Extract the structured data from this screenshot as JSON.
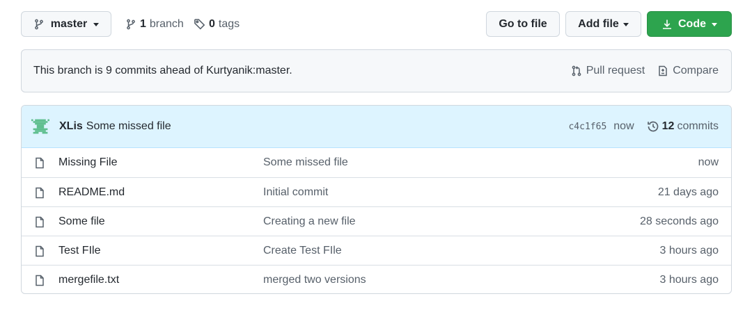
{
  "toolbar": {
    "branch_name": "master",
    "branches_count": "1",
    "branches_label": "branch",
    "tags_count": "0",
    "tags_label": "tags",
    "goto_file_label": "Go to file",
    "add_file_label": "Add file",
    "code_label": "Code"
  },
  "ahead_notice": {
    "text": "This branch is 9 commits ahead of Kurtyanik:master.",
    "pull_request_label": "Pull request",
    "compare_label": "Compare"
  },
  "latest_commit": {
    "author": "XLis",
    "message": "Some missed file",
    "sha": "c4c1f65",
    "time": "now",
    "commits_count": "12",
    "commits_label": "commits"
  },
  "files": [
    {
      "name": "Missing File",
      "commit": "Some missed file",
      "age": "now"
    },
    {
      "name": "README.md",
      "commit": "Initial commit",
      "age": "21 days ago"
    },
    {
      "name": "Some file",
      "commit": "Creating a new file",
      "age": "28 seconds ago"
    },
    {
      "name": "Test FIle",
      "commit": "Create Test FIle",
      "age": "3 hours ago"
    },
    {
      "name": "mergefile.txt",
      "commit": "merged two versions",
      "age": "3 hours ago"
    }
  ],
  "colors": {
    "primary_button": "#2da44e",
    "commit_bar_bg": "#ddf4ff",
    "avatar": "#5fbf8f"
  },
  "icons": {
    "branch": "git-branch-icon",
    "tag": "tag-icon",
    "download": "download-icon",
    "pull_request": "git-pull-request-icon",
    "compare": "file-diff-icon",
    "history": "history-icon",
    "file": "file-icon"
  }
}
